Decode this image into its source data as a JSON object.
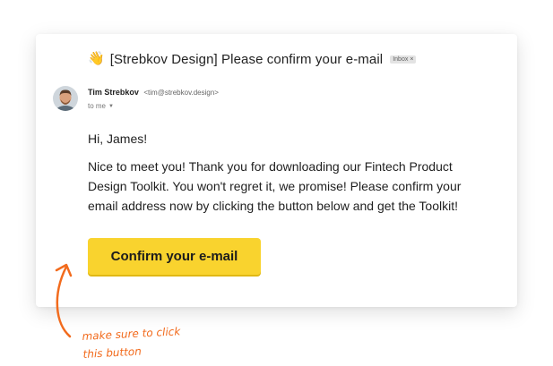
{
  "email": {
    "wave_icon": "👋",
    "subject": "[Strebkov Design] Please confirm your e-mail",
    "badge": "Inbox",
    "badge_close": "×",
    "sender_name": "Tim Strebkov",
    "sender_email": "<tim@strebkov.design>",
    "recipient": "to me",
    "greeting": "Hi, James!",
    "body": "Nice to meet you! Thank you for downloading our Fintech Product Design Toolkit. You won't regret it, we promise! Please confirm your email address now by clicking the button below and get the Toolkit!",
    "button_label": "Confirm your e-mail"
  },
  "annotation": {
    "line1": "make sure to click",
    "line2": "this button",
    "color": "#f26b1d"
  },
  "colors": {
    "button": "#f9d32e",
    "text": "#1f1f1f"
  }
}
